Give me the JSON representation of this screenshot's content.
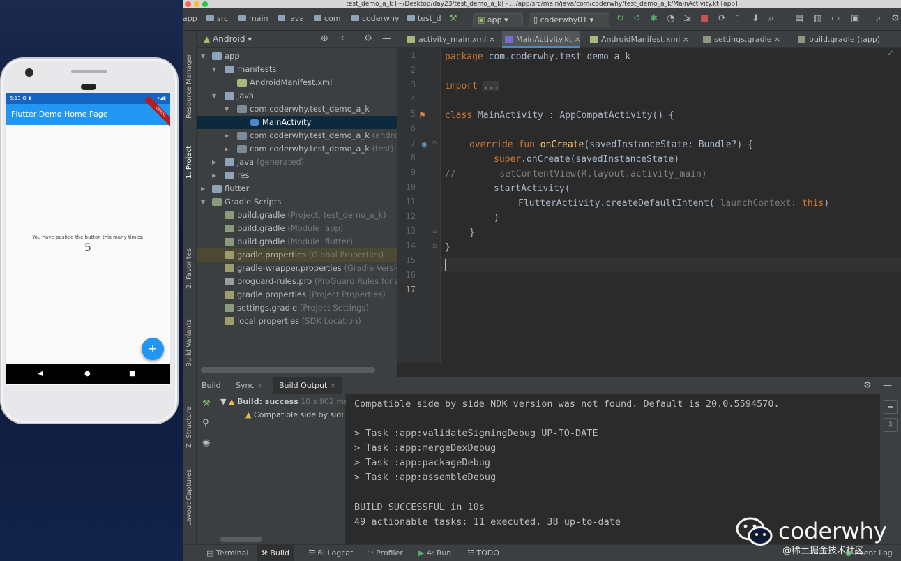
{
  "emulator": {
    "status_time": "5:13",
    "app_bar_title": "Flutter Demo Home Page",
    "debug_banner": "DEBUG",
    "counter_label": "You have pushed the button this many times:",
    "counter_value": "5",
    "fab_label": "+",
    "nav_back": "◀",
    "nav_home": "●",
    "nav_recents": "■"
  },
  "ide": {
    "window_title": "test_demo_a_k [~/Desktop/day23/test_demo_a_k] - .../app/src/main/java/com/coderwhy/test_demo_a_k/MainActivity.kt [app]",
    "breadcrumbs": [
      "app",
      "src",
      "main",
      "java",
      "com",
      "coderwhy",
      "test_d"
    ],
    "run_config": "app",
    "device": "coderwhy01",
    "left_stripe": [
      "Resource Manager",
      "1: Project",
      "2: Favorites",
      "Build Variants",
      "Z: Structure",
      "Layout Captures"
    ],
    "project_view": "Android",
    "tree": [
      {
        "label": "app",
        "hint": ""
      },
      {
        "label": "manifests",
        "hint": ""
      },
      {
        "label": "AndroidManifest.xml",
        "hint": ""
      },
      {
        "label": "java",
        "hint": ""
      },
      {
        "label": "com.coderwhy.test_demo_a_k",
        "hint": ""
      },
      {
        "label": "MainActivity",
        "hint": ""
      },
      {
        "label": "com.coderwhy.test_demo_a_k",
        "hint": "(androidTest)"
      },
      {
        "label": "com.coderwhy.test_demo_a_k",
        "hint": "(test)"
      },
      {
        "label": "java",
        "hint": "(generated)"
      },
      {
        "label": "res",
        "hint": ""
      },
      {
        "label": "flutter",
        "hint": ""
      },
      {
        "label": "Gradle Scripts",
        "hint": ""
      },
      {
        "label": "build.gradle",
        "hint": "(Project: test_demo_a_k)"
      },
      {
        "label": "build.gradle",
        "hint": "(Module: app)"
      },
      {
        "label": "build.gradle",
        "hint": "(Module: flutter)"
      },
      {
        "label": "gradle.properties",
        "hint": "(Global Properties)"
      },
      {
        "label": "gradle-wrapper.properties",
        "hint": "(Gradle Version)"
      },
      {
        "label": "proguard-rules.pro",
        "hint": "(ProGuard Rules for app)"
      },
      {
        "label": "gradle.properties",
        "hint": "(Project Properties)"
      },
      {
        "label": "settings.gradle",
        "hint": "(Project Settings)"
      },
      {
        "label": "local.properties",
        "hint": "(SDK Location)"
      }
    ],
    "editor_tabs": [
      "activity_main.xml",
      "MainActivity.kt",
      "AndroidManifest.xml",
      "settings.gradle",
      "build.gradle (:app)"
    ],
    "line_numbers": [
      "1",
      "2",
      "3",
      "4",
      "5",
      "6",
      "7",
      "8",
      "9",
      "10",
      "11",
      "12",
      "13",
      "14",
      "15",
      "16",
      "17"
    ],
    "code": {
      "l1_kw": "package",
      "l1_rest": " com.coderwhy.test_demo_a_k",
      "l3_kw": "import",
      "l3_fold": "...",
      "l7_kw": "class",
      "l7_rest": " MainActivity : AppCompatActivity() {",
      "l9_kw": "override fun",
      "l9_fn": "onCreate",
      "l9_rest": "(savedInstanceState: Bundle?) {",
      "l10_kw": "super",
      "l10_rest": ".onCreate(savedInstanceState)",
      "l11": "//        setContentView(R.layout.activity_main)",
      "l12": "startActivity(",
      "l13_a": "FlutterActivity.createDefaultIntent(",
      "l13_param": "launchContext:",
      "l13_kw": "this",
      "l13_b": ")",
      "l14": ")",
      "l15": "}",
      "l16": "}"
    },
    "build": {
      "label": "Build:",
      "tab_sync": "Sync",
      "tab_output": "Build Output",
      "status": "Build: success",
      "status_time": "10 s 902 ms",
      "warning": "Compatible side by side NDK version was not found.",
      "output": [
        "Compatible side by side NDK version was not found. Default is 20.0.5594570.",
        "",
        "> Task :app:validateSigningDebug UP-TO-DATE",
        "> Task :app:mergeDexDebug",
        "> Task :app:packageDebug",
        "> Task :app:assembleDebug",
        "",
        "BUILD SUCCESSFUL in 10s",
        "49 actionable tasks: 11 executed, 38 up-to-date"
      ]
    },
    "bottom_tabs": [
      "Terminal",
      "Build",
      "6: Logcat",
      "Profiler",
      "4: Run",
      "TODO"
    ],
    "event_log": "Event Log"
  },
  "watermark": {
    "name": "coderwhy",
    "sub": "@稀土掘金技术社区"
  },
  "colors": {
    "ide_bg": "#2b2b2b",
    "panel_bg": "#3c3f41",
    "keyword": "#cc7832",
    "function": "#ffc66d",
    "flutter_blue": "#2196f3"
  }
}
